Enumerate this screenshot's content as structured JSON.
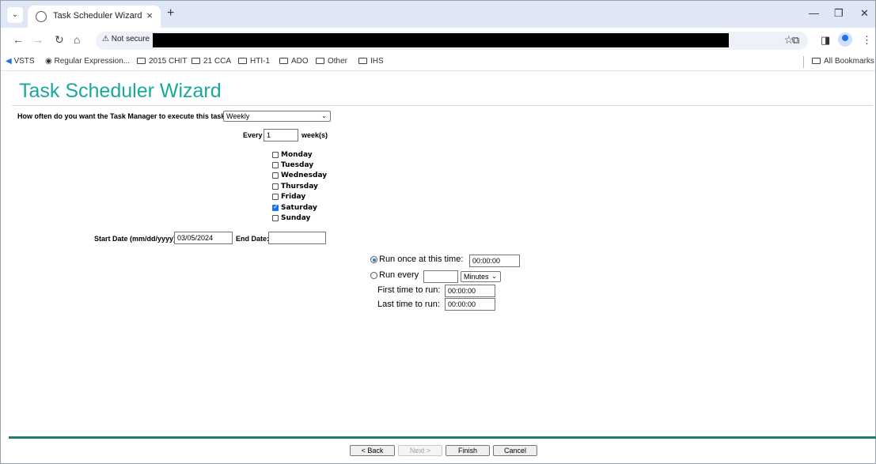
{
  "browser": {
    "tab_title": "Task Scheduler Wizard",
    "tab_close": "×",
    "new_tab": "+",
    "security": "⚠ Not secure",
    "bookmarks": [
      "VSTS",
      "Regular Expression...",
      "2015 CHIT",
      "21 CCA",
      "HTI-1",
      "ADO",
      "Other",
      "IHS"
    ],
    "all_bookmarks": "All Bookmarks"
  },
  "page": {
    "title": "Task Scheduler Wizard",
    "frequency_question": "How often do you want the Task Manager to execute this task?",
    "frequency_value": "Weekly",
    "every_label": "Every",
    "every_value": "1",
    "weeks_label": "week(s)",
    "days": [
      {
        "label": "Monday",
        "checked": false
      },
      {
        "label": "Tuesday",
        "checked": false
      },
      {
        "label": "Wednesday",
        "checked": false
      },
      {
        "label": "Thursday",
        "checked": false
      },
      {
        "label": "Friday",
        "checked": false
      },
      {
        "label": "Saturday",
        "checked": true
      },
      {
        "label": "Sunday",
        "checked": false
      }
    ],
    "start_date_label": "Start Date (mm/dd/yyyy):",
    "start_date_value": "03/05/2024",
    "end_date_label": "End Date:",
    "end_date_value": "",
    "run_once_label": "Run once at this time:",
    "run_once_value": "00:00:00",
    "run_every_label": "Run every",
    "run_every_value": "",
    "run_every_unit": "Minutes",
    "first_time_label": "First time to run:",
    "first_time_value": "00:00:00",
    "last_time_label": "Last time to run:",
    "last_time_value": "00:00:00"
  },
  "buttons": {
    "back": "< Back",
    "next": "Next >",
    "finish": "Finish",
    "cancel": "Cancel"
  },
  "colors": {
    "title": "#1aa89a",
    "footer_rule": "#1e7c70"
  }
}
